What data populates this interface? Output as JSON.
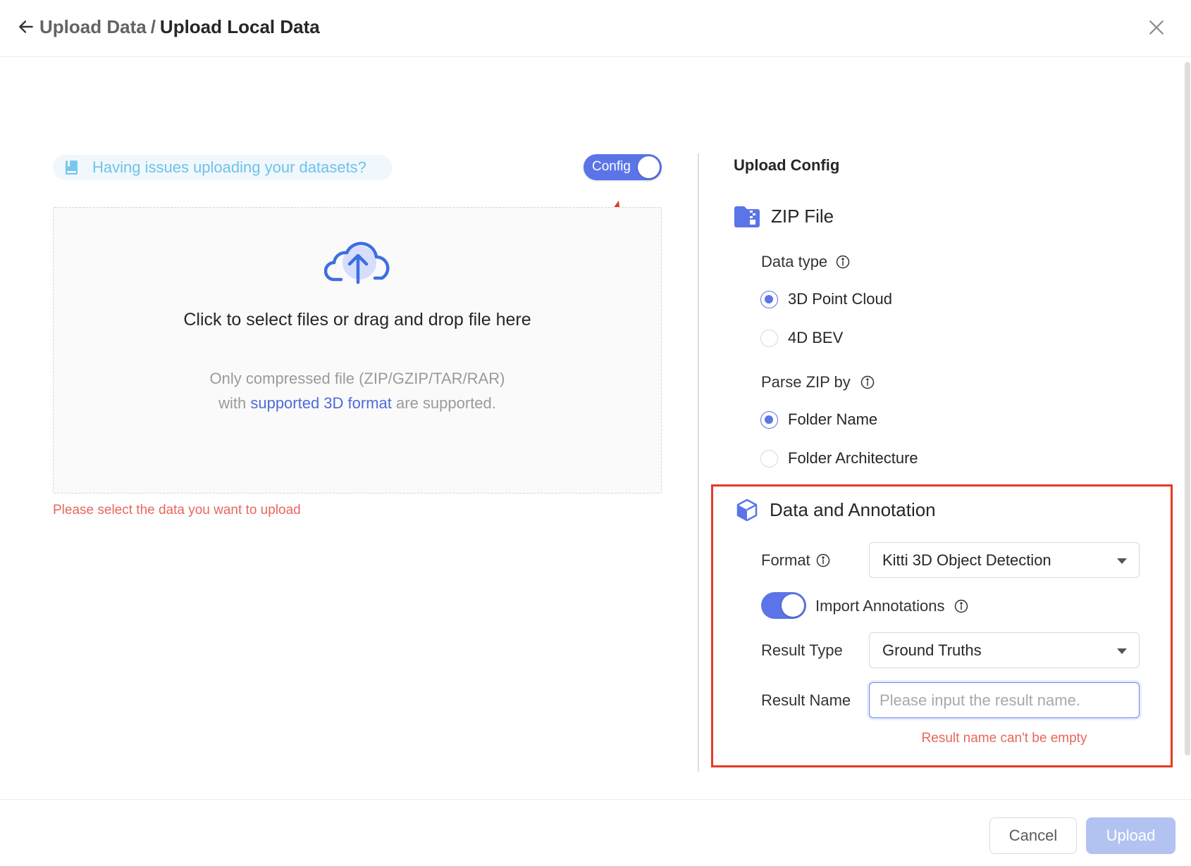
{
  "header": {
    "breadcrumb_parent": "Upload Data",
    "breadcrumb_separator": "/",
    "breadcrumb_current": "Upload Local Data",
    "back_icon": "arrow-left-icon",
    "close_icon": "close-icon"
  },
  "left": {
    "help_text": "Having issues uploading your datasets?",
    "help_icon": "book-icon",
    "config_toggle": {
      "label": "Config",
      "on": true
    },
    "dropzone": {
      "icon": "cloud-upload-icon",
      "main_text": "Click to select files or drag and drop file here",
      "sub_line1": "Only compressed file (ZIP/GZIP/TAR/RAR)",
      "sub_line2_prefix": "with",
      "sub_link": "supported 3D format",
      "sub_line2_suffix": "are supported."
    },
    "error": "Please select the data you want to upload"
  },
  "right": {
    "title": "Upload Config",
    "zip_section": {
      "title": "ZIP File",
      "icon": "zip-folder-icon",
      "data_type": {
        "label": "Data type",
        "options": [
          {
            "label": "3D Point Cloud",
            "selected": true
          },
          {
            "label": "4D BEV",
            "selected": false
          }
        ]
      },
      "parse_by": {
        "label": "Parse ZIP by",
        "options": [
          {
            "label": "Folder Name",
            "selected": true
          },
          {
            "label": "Folder Architecture",
            "selected": false
          }
        ]
      }
    },
    "annotation_section": {
      "title": "Data and Annotation",
      "icon": "cube-icon",
      "format_label": "Format",
      "format_value": "Kitti 3D Object Detection",
      "import_label": "Import Annotations",
      "import_on": true,
      "result_type_label": "Result Type",
      "result_type_value": "Ground Truths",
      "result_name_label": "Result Name",
      "result_name_value": "",
      "result_name_placeholder": "Please input the result name.",
      "result_name_error": "Result name can't be empty"
    }
  },
  "footer": {
    "cancel_label": "Cancel",
    "upload_label": "Upload",
    "upload_disabled": true
  },
  "colors": {
    "accent": "#5b74e8",
    "error": "#e8675c",
    "annotation_highlight": "#e53a25",
    "help_text": "#6ec3ea",
    "upload_disabled": "#b3c3f1"
  }
}
